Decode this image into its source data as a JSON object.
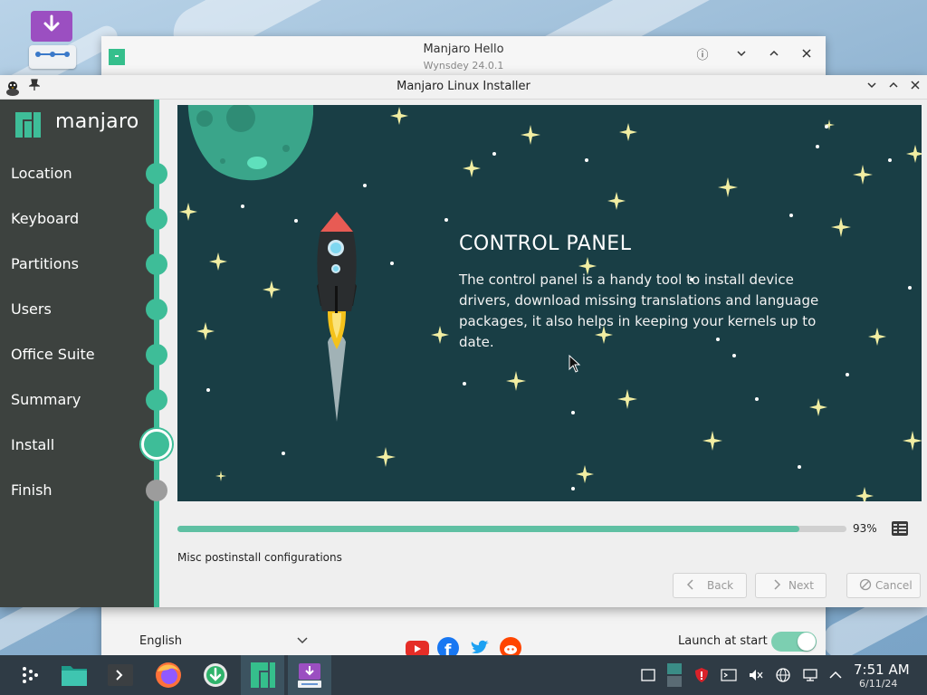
{
  "hello": {
    "title": "Manjaro Hello",
    "subtitle": "Wynsdey 24.0.1",
    "language": "English",
    "launch_label": "Launch at start",
    "launch_enabled": true
  },
  "installer": {
    "title": "Manjaro Linux Installer",
    "brand": "manjaro",
    "steps": [
      {
        "label": "Location",
        "state": "done"
      },
      {
        "label": "Keyboard",
        "state": "done"
      },
      {
        "label": "Partitions",
        "state": "done"
      },
      {
        "label": "Users",
        "state": "done"
      },
      {
        "label": "Office Suite",
        "state": "done"
      },
      {
        "label": "Summary",
        "state": "done"
      },
      {
        "label": "Install",
        "state": "current"
      },
      {
        "label": "Finish",
        "state": "pending"
      }
    ],
    "slide": {
      "title": "CONTROL PANEL",
      "text": "The control panel is a handy tool to install device drivers, download missing translations and language packages, it also helps in keeping your kernels up to date."
    },
    "progress": 0.93,
    "progress_label": "93%",
    "status": "Misc postinstall configurations",
    "buttons": {
      "back": "Back",
      "next": "Next",
      "cancel": "Cancel"
    }
  },
  "taskbar": {
    "time": "7:51 AM",
    "date": "6/11/24",
    "apps": [
      "app-launcher-icon",
      "file-manager-icon",
      "terminal-icon",
      "firefox-icon",
      "update-icon",
      "manjaro-hello-icon",
      "installer-icon"
    ]
  },
  "colors": {
    "accent": "#3ebd98",
    "sidebar": "#3d423f",
    "slide_bg": "#193e45",
    "taskbar": "#2f3b45"
  }
}
